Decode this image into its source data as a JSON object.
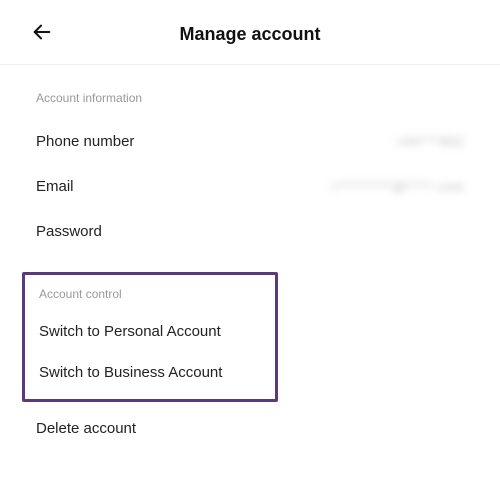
{
  "header": {
    "title": "Manage account"
  },
  "accountInfo": {
    "sectionLabel": "Account information",
    "items": [
      {
        "label": "Phone number",
        "value": "+44****852"
      },
      {
        "label": "Email",
        "value": "r**********@*****.com"
      },
      {
        "label": "Password",
        "value": ""
      }
    ]
  },
  "accountControl": {
    "sectionLabel": "Account control",
    "items": [
      {
        "label": "Switch to Personal Account"
      },
      {
        "label": "Switch to Business Account"
      }
    ]
  },
  "deleteAccount": {
    "label": "Delete account"
  }
}
